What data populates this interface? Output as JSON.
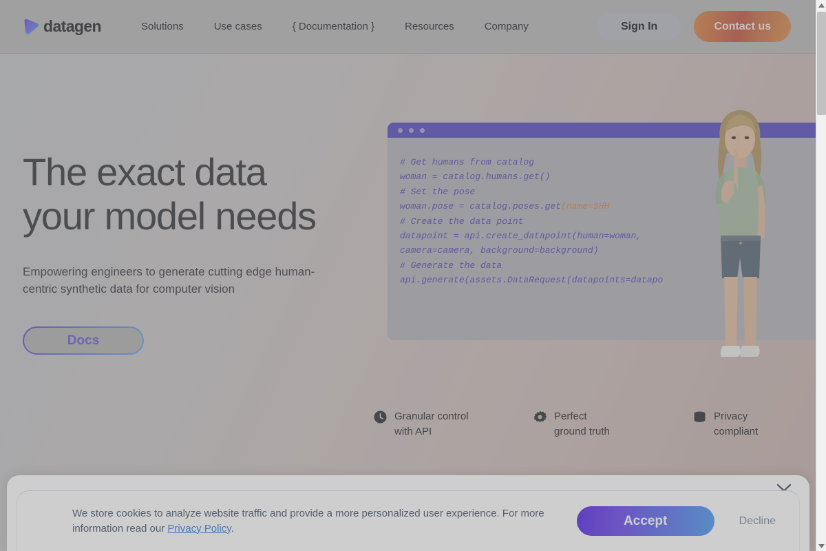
{
  "nav": {
    "logo_text": "datagen",
    "logo_icon": "datagen-shield-logo",
    "links": [
      {
        "label": "Solutions"
      },
      {
        "label": "Use cases"
      },
      {
        "label": "{ Documentation }"
      },
      {
        "label": "Resources"
      },
      {
        "label": "Company"
      }
    ],
    "sign_in_label": "Sign In",
    "contact_label": "Contact us"
  },
  "hero": {
    "headline": "The exact data your model needs",
    "subhead": "Empowering engineers to generate cutting edge human-centric synthetic data for computer vision",
    "docs_label": "Docs"
  },
  "code": {
    "line1": "# Get humans from catalog",
    "line2": "woman = catalog.humans.get()",
    "line3": "# Set the pose",
    "line4a": "woman.pose = catalog.poses.get",
    "line4b": "(name=SHH",
    "line5": "# Create the data point",
    "line6": "datapoint = api.create_datapoint(human=woman,",
    "line7": "camera=camera, background=background)",
    "line8": "# Generate the data",
    "line9": "api.generate(assets.DataRequest(datapoints=datapo"
  },
  "features": [
    {
      "icon": "clock-icon",
      "line1": "Granular control",
      "line2": "with API"
    },
    {
      "icon": "gear-icon",
      "line1": "Perfect",
      "line2": "ground truth"
    },
    {
      "icon": "database-icon",
      "line1": "Privacy",
      "line2": "compliant"
    }
  ],
  "cookie": {
    "text_part1": "We store cookies to analyze website traffic and provide a more personalized user experience. For more information read our ",
    "link_label": "Privacy Policy",
    "text_part2": ".",
    "accept_label": "Accept",
    "decline_label": "Decline",
    "collapse_icon": "chevron-down-icon"
  },
  "colors": {
    "brand_purple": "#5a4fc0",
    "accent_orange": "#c35746",
    "accept_blue": "#4d9cf0",
    "link_blue": "#3d7bd9"
  }
}
